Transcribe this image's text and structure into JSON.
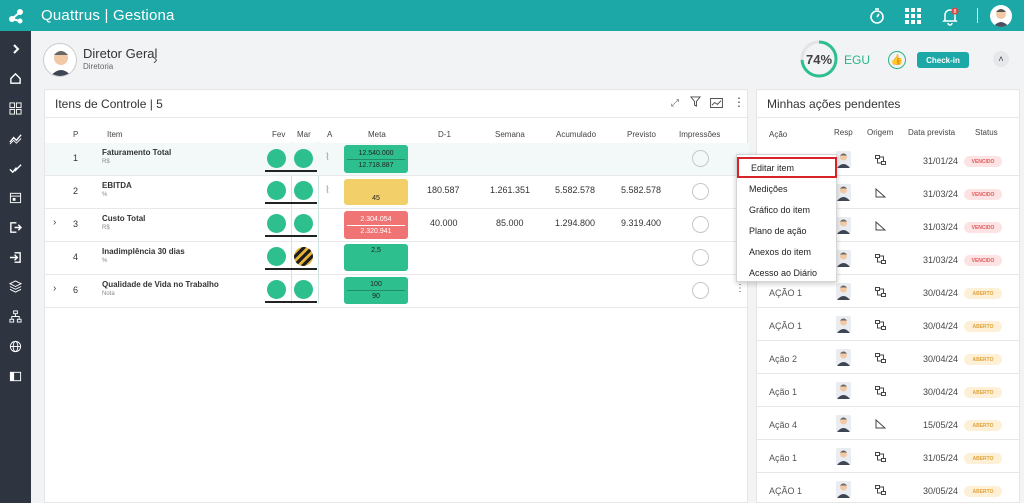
{
  "app": {
    "brand": "Quattrus | Gestiona"
  },
  "topbar": {
    "icons": [
      "stopwatch-icon",
      "apps-grid-icon",
      "bell-icon",
      "user-avatar"
    ],
    "notification_count": "8"
  },
  "rail": {
    "icons": [
      "chevron-right-icon",
      "home-icon",
      "dashboard-icon",
      "chart-icon",
      "check-icon",
      "calendar-icon",
      "exit-icon",
      "login-icon",
      "layers-icon",
      "org-chart-icon",
      "globe-icon",
      "book-icon"
    ]
  },
  "header": {
    "user_name": "Diretor Geral",
    "user_role": "Diretoria",
    "gauge_value": "74%",
    "gauge_fraction": 0.74,
    "egu": "EGU",
    "checkin": "Check-in"
  },
  "control": {
    "title": "Itens de Controle | 5",
    "columns": {
      "p": "P",
      "item": "Item",
      "fev": "Fev",
      "mar": "Mar",
      "a": "A",
      "meta": "Meta",
      "d1": "D-1",
      "semana": "Semana",
      "acumulado": "Acumulado",
      "previsto": "Previsto",
      "impressoes": "Impressões"
    },
    "rows": [
      {
        "p": "1",
        "name": "Faturamento Total",
        "unit": "R$",
        "meta_top": "12.540.000",
        "meta_bottom": "12.718.887",
        "d1": "",
        "semana": "",
        "acumulado": "",
        "previsto": ""
      },
      {
        "p": "2",
        "name": "EBITDA",
        "unit": "%",
        "meta_top": "45",
        "meta_bottom": "",
        "d1": "180.587",
        "semana": "1.261.351",
        "acumulado": "5.582.578",
        "previsto": "5.582.578"
      },
      {
        "p": "3",
        "name": "Custo Total",
        "unit": "R$",
        "meta_top": "2.304.054",
        "meta_bottom": "2.320.941",
        "d1": "40.000",
        "semana": "85.000",
        "acumulado": "1.294.800",
        "previsto": "9.319.400"
      },
      {
        "p": "4",
        "name": "Inadimplência 30 dias",
        "unit": "%",
        "meta_top": "2,5",
        "meta_bottom": "",
        "d1": "",
        "semana": "",
        "acumulado": "",
        "previsto": ""
      },
      {
        "p": "6",
        "name": "Qualidade de Vida no Trabalho",
        "unit": "Nota",
        "meta_top": "100",
        "meta_bottom": "90",
        "d1": "",
        "semana": "",
        "acumulado": "",
        "previsto": ""
      }
    ]
  },
  "menu": {
    "items": [
      "Editar item",
      "Medições",
      "Gráfico do item",
      "Plano de ação",
      "Anexos do item",
      "Acesso ao Diário"
    ]
  },
  "pending": {
    "title": "Minhas ações pendentes",
    "columns": {
      "acao": "Ação",
      "resp": "Resp",
      "origem": "Origem",
      "data": "Data prevista",
      "status": "Status"
    },
    "rows": [
      {
        "acao": "",
        "data": "31/01/24",
        "status": "VENCIDO"
      },
      {
        "acao": "",
        "data": "31/03/24",
        "status": "VENCIDO"
      },
      {
        "acao": "",
        "data": "31/03/24",
        "status": "VENCIDO"
      },
      {
        "acao": "",
        "data": "31/03/24",
        "status": "VENCIDO"
      },
      {
        "acao": "AÇÃO 1",
        "data": "30/04/24",
        "status": "ABERTO"
      },
      {
        "acao": "AÇÃO 1",
        "data": "30/04/24",
        "status": "ABERTO"
      },
      {
        "acao": "Ação 2",
        "data": "30/04/24",
        "status": "ABERTO"
      },
      {
        "acao": "Ação 1",
        "data": "30/04/24",
        "status": "ABERTO"
      },
      {
        "acao": "Ação 4",
        "data": "15/05/24",
        "status": "ABERTO"
      },
      {
        "acao": "Ação 1",
        "data": "31/05/24",
        "status": "ABERTO"
      },
      {
        "acao": "AÇÃO 1",
        "data": "30/05/24",
        "status": "ABERTO"
      }
    ]
  },
  "colors": {
    "teal": "#1ba8a7",
    "green": "#2ebf8e",
    "yellow": "#f3cf6a",
    "red": "#f07474",
    "rail": "#2f3540"
  }
}
